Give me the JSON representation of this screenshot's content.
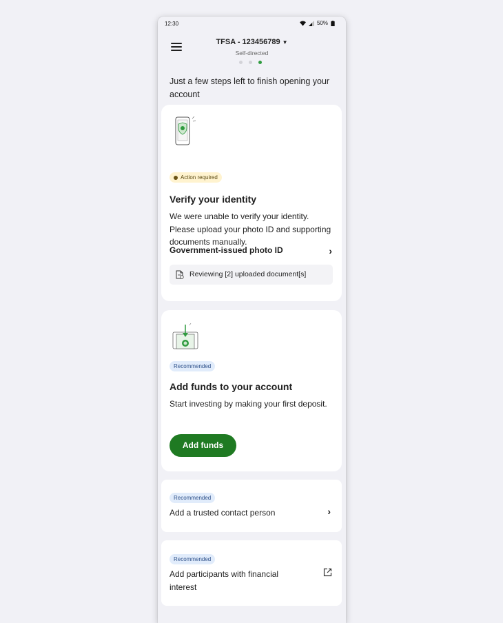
{
  "status_bar": {
    "time": "12:30",
    "battery": "50%"
  },
  "header": {
    "account_title": "TFSA - 123456789",
    "account_subtitle": "Self-directed"
  },
  "intro_text": "Just a few steps left to finish opening your account",
  "verify_card": {
    "badge": "Action required",
    "title": "Verify your identity",
    "body": "We were unable to verify your identity. Please upload your photo ID and supporting documents manually.",
    "link_label": "Government-issued photo ID",
    "doc_status": "Reviewing [2] uploaded document[s]"
  },
  "funds_card": {
    "badge": "Recommended",
    "title": "Add funds to your account",
    "body": "Start investing by making your first deposit.",
    "button_label": "Add funds"
  },
  "contact_card": {
    "badge": "Recommended",
    "label": "Add a trusted contact person"
  },
  "participants_card": {
    "badge": "Recommended",
    "label": "Add participants with financial interest"
  },
  "icons": {
    "menu": "menu-icon",
    "dropdown": "caret-down-icon",
    "wifi": "wifi-icon",
    "signal": "signal-icon",
    "battery": "battery-icon",
    "chevron": "chevron-right-icon",
    "document": "document-icon",
    "external": "external-link-icon"
  },
  "colors": {
    "accent": "#1f7a22",
    "warn_badge_bg": "#fff3cf",
    "rec_badge_bg": "#e1ecfb",
    "active_dot": "#2f9b3f"
  }
}
